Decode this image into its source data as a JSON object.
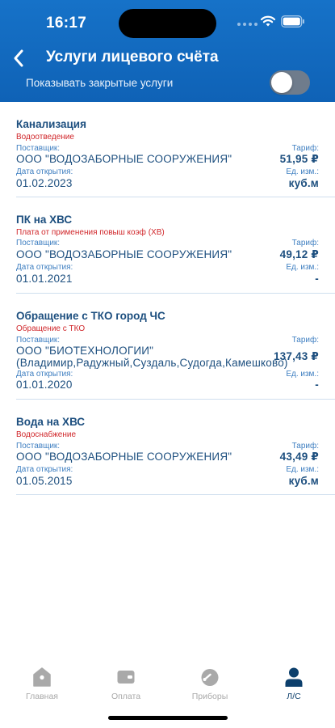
{
  "status_bar": {
    "time": "16:17"
  },
  "header": {
    "title": "Услуги лицевого счёта",
    "toggle_label": "Показывать закрытые услуги",
    "toggle_on": false
  },
  "labels": {
    "supplier": "Поставщик:",
    "open_date": "Дата открытия:",
    "tariff": "Тариф:",
    "unit": "Ед. изм.:"
  },
  "services": [
    {
      "name": "Канализация",
      "type": "Водоотведение",
      "supplier": "ООО \"ВОДОЗАБОРНЫЕ СООРУЖЕНИЯ\"",
      "open_date": "01.02.2023",
      "tariff": "51,95 ₽",
      "unit": "куб.м"
    },
    {
      "name": "ПК на ХВС",
      "type": "Плата от применения повыш коэф (ХВ)",
      "supplier": "ООО \"ВОДОЗАБОРНЫЕ СООРУЖЕНИЯ\"",
      "open_date": "01.01.2021",
      "tariff": "49,12 ₽",
      "unit": "-"
    },
    {
      "name": "Обращение с ТКО город ЧС",
      "type": "Обращение с ТКО",
      "supplier": "ООО \"БИОТЕХНОЛОГИИ\"",
      "supplier_line2": "(Владимир,Радужный,Суздаль,Судогда,Камешково)",
      "open_date": "01.01.2020",
      "tariff": "137,43 ₽",
      "unit": "-"
    },
    {
      "name": "Вода на ХВС",
      "type": "Водоснабжение",
      "supplier": "ООО \"ВОДОЗАБОРНЫЕ СООРУЖЕНИЯ\"",
      "open_date": "01.05.2015",
      "tariff": "43,49 ₽",
      "unit": "куб.м"
    }
  ],
  "tabs": [
    {
      "label": "Главная",
      "icon": "home-icon",
      "active": false
    },
    {
      "label": "Оплата",
      "icon": "wallet-icon",
      "active": false
    },
    {
      "label": "Приборы",
      "icon": "meter-icon",
      "active": false
    },
    {
      "label": "Л/С",
      "icon": "person-icon",
      "active": true
    }
  ],
  "colors": {
    "header": "#1672c8",
    "accent_dark": "#1d4f7f",
    "label_blue": "#3f7fc1",
    "type_red": "#d0262a",
    "tab_inactive": "#a9a9a9",
    "tab_active": "#0c3f6c"
  }
}
